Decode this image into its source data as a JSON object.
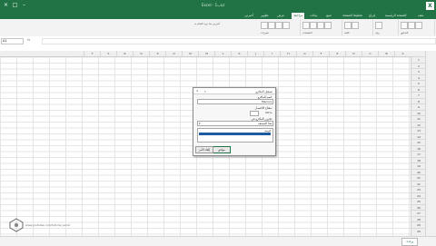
{
  "window": {
    "title": "Excel - كتاب1",
    "app_logo": "X"
  },
  "tabs": [
    "ملف",
    "الصفحة الرئيسية",
    "إدراج",
    "تخطيط الصفحة",
    "صيغ",
    "بيانات",
    "مراجعة",
    "عرض",
    "تطوير",
    "أخبرني"
  ],
  "active_tab_index": 6,
  "ribbon": {
    "groups": [
      {
        "label": "التدقيق",
        "buttons": 3
      },
      {
        "label": "رؤى",
        "buttons": 1
      },
      {
        "label": "اللغة",
        "buttons": 2
      },
      {
        "label": "التعليقات",
        "buttons": 4
      },
      {
        "label": "تغييرات",
        "buttons": 4
      }
    ],
    "tell_me_placeholder": "أخبرني بما تريد القيام به"
  },
  "formula_bar": {
    "name_box": "A1",
    "fx": "fx",
    "value": ""
  },
  "columns": [
    "T",
    "S",
    "R",
    "Q",
    "P",
    "O",
    "N",
    "M",
    "L",
    "K",
    "J",
    "I",
    "H",
    "G",
    "F",
    "E",
    "D",
    "C",
    "B",
    "A"
  ],
  "rows": [
    "1",
    "2",
    "3",
    "4",
    "5",
    "6",
    "7",
    "8",
    "9",
    "10",
    "11",
    "12",
    "13",
    "14",
    "15",
    "16",
    "17",
    "18",
    "19",
    "20",
    "21",
    "22",
    "23",
    "24",
    "25",
    "26",
    "27",
    "28",
    "29",
    "30"
  ],
  "dialog": {
    "title": "تسجيل الماكرو",
    "help": "?",
    "close": "×",
    "macro_name_label": "اسم الماكرو:",
    "macro_name_value": "Macro1",
    "shortcut_label": "مفتاح الاختصار:",
    "shortcut_prefix": "Ctrl+",
    "store_label": "تخزين الماكرو في:",
    "store_value": "هذا المصنف",
    "description_label": "الوصف:",
    "ok": "موافق",
    "cancel": "إلغاء الأمر"
  },
  "sheet_tab": "ورقة1",
  "watermark": "www.youtube.com/tutorial_excel"
}
